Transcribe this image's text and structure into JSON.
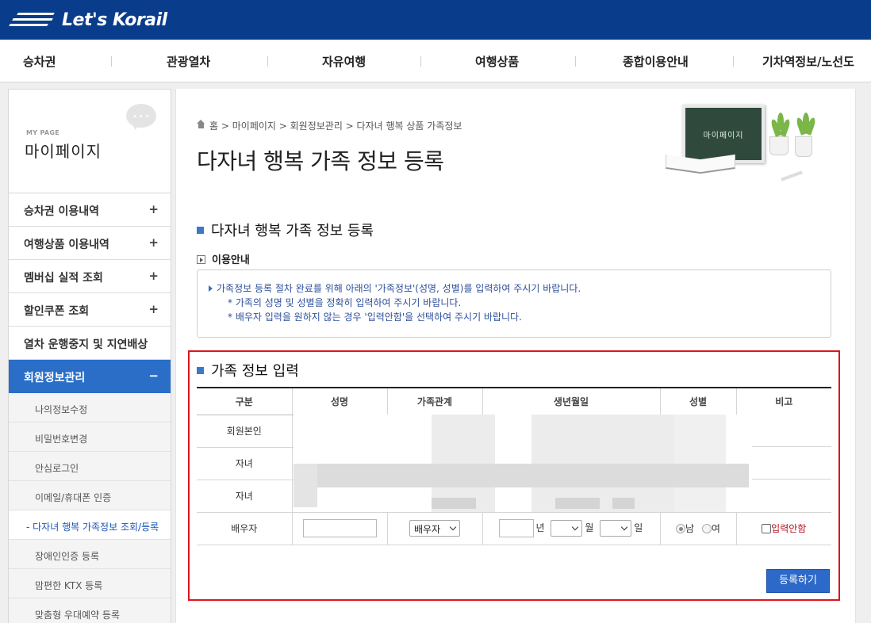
{
  "brand": {
    "logo_text": "Let's Korail"
  },
  "gnb": [
    {
      "label": "승차권"
    },
    {
      "label": "관광열차"
    },
    {
      "label": "자유여행"
    },
    {
      "label": "여행상품"
    },
    {
      "label": "종합이용안내"
    },
    {
      "label": "기차역정보/노선도"
    }
  ],
  "sidebar": {
    "small_title": "MY PAGE",
    "title": "마이페이지",
    "items": [
      {
        "label": "승차권 이용내역",
        "toggle": "+"
      },
      {
        "label": "여행상품 이용내역",
        "toggle": "+"
      },
      {
        "label": "멤버십 실적 조회",
        "toggle": "+"
      },
      {
        "label": "할인쿠폰 조회",
        "toggle": "+"
      },
      {
        "label": "열차 운행중지 및 지연배상",
        "toggle": ""
      },
      {
        "label": "회원정보관리",
        "toggle": "−"
      }
    ],
    "sub_items": [
      {
        "label": "나의정보수정"
      },
      {
        "label": "비밀번호변경"
      },
      {
        "label": "안심로그인"
      },
      {
        "label": "이메일/휴대폰 인증"
      },
      {
        "label": "- 다자녀 행복 가족정보 조회/등록"
      },
      {
        "label": "장애인인증 등록"
      },
      {
        "label": "맘편한 KTX 등록"
      },
      {
        "label": "맞춤형 우대예약 등록"
      }
    ]
  },
  "breadcrumb": {
    "home": "홈",
    "path": "> 마이페이지 > 회원정보관리 > 다자녀 행복 상품 가족정보"
  },
  "page_title": "다자녀 행복 가족 정보 등록",
  "illustration": {
    "board_text": "마이페이지"
  },
  "section1": {
    "title": "다자녀 행복 가족 정보 등록",
    "guide_title": "이용안내",
    "guide_lines": [
      "가족정보 등록 절차 완료를 위해 아래의 '가족정보'(성명, 성별)를 입력하여 주시기 바랍니다.",
      "* 가족의 성명 및 성별을 정확히 입력하여 주시기 바랍니다.",
      "* 배우자 입력을 원하지 않는 경우 '입력안함'을 선택하여 주시기 바랍니다."
    ]
  },
  "section2": {
    "title": "가족 정보 입력",
    "columns": [
      "구분",
      "성명",
      "가족관계",
      "생년월일",
      "성별",
      "비고"
    ],
    "rows": [
      {
        "type": "회원본인"
      },
      {
        "type": "자녀"
      },
      {
        "type": "자녀"
      }
    ],
    "spouse": {
      "type": "배우자",
      "name_value": "",
      "relation_selected": "배우자",
      "year_unit": "년",
      "month_unit": "월",
      "day_unit": "일",
      "gender_male": "남",
      "gender_female": "여",
      "gender_selected": "male",
      "skip_label": "입력안함"
    },
    "submit_label": "등록하기"
  },
  "colors": {
    "header_bg": "#0a3c8c",
    "active_menu": "#2a6ec8",
    "highlight_border": "#e0141e",
    "button_bg": "#2c69c9"
  }
}
